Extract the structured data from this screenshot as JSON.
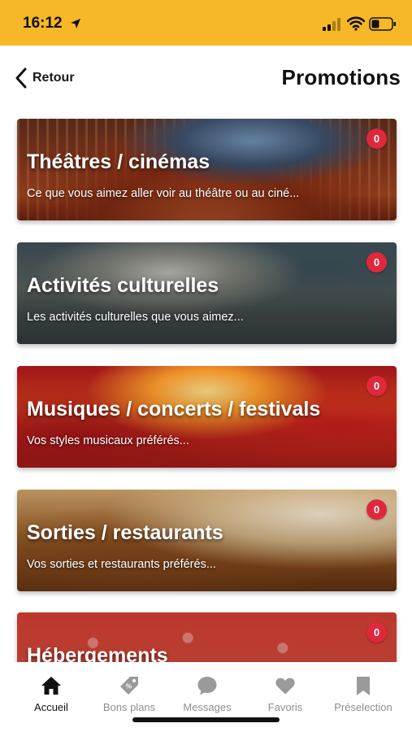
{
  "status_bar": {
    "time": "16:12",
    "background_color": "#f6b826",
    "icons": [
      "location-arrow-icon",
      "signal-icon",
      "wifi-icon",
      "battery-icon"
    ]
  },
  "header": {
    "back_label": "Retour",
    "title": "Promotions"
  },
  "cards": [
    {
      "title": "Théâtres / cinémas",
      "subtitle": "Ce que vous aimez aller voir au théâtre ou au ciné...",
      "badge": "0"
    },
    {
      "title": "Activités culturelles",
      "subtitle": "Les activités culturelles que vous aimez...",
      "badge": "0"
    },
    {
      "title": "Musiques / concerts / festivals",
      "subtitle": "Vos styles musicaux préférés...",
      "badge": "0"
    },
    {
      "title": "Sorties / restaurants",
      "subtitle": "Vos sorties et restaurants préférés...",
      "badge": "0"
    },
    {
      "title": "Hébergements",
      "subtitle": "",
      "badge": "0"
    }
  ],
  "badge_color": "#e0283c",
  "tab_bar": {
    "tabs": [
      {
        "label": "Accueil",
        "icon": "home-icon",
        "active": true
      },
      {
        "label": "Bons plans",
        "icon": "tag-icon",
        "active": false
      },
      {
        "label": "Messages",
        "icon": "chat-bubble-icon",
        "active": false
      },
      {
        "label": "Favoris",
        "icon": "heart-icon",
        "active": false
      },
      {
        "label": "Préselection",
        "icon": "bookmark-icon",
        "active": false
      }
    ]
  }
}
